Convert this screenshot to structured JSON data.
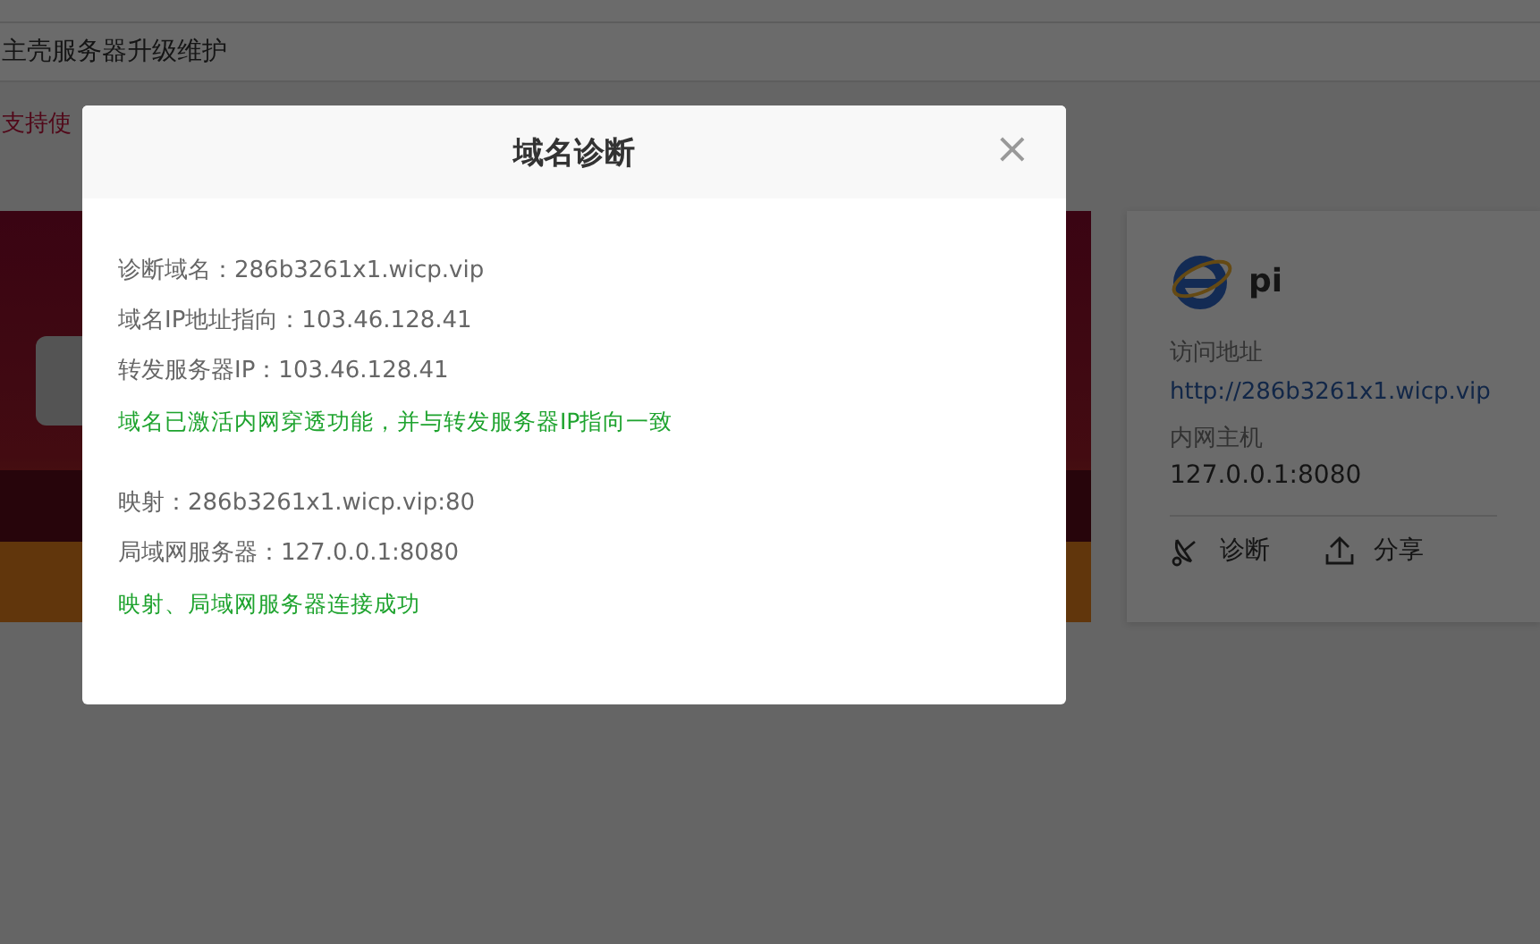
{
  "notice": {
    "text": "主壳服务器升级维护"
  },
  "tip": {
    "text": "支持使"
  },
  "card": {
    "title": "pi",
    "url_label": "访问地址",
    "url": "http://286b3261x1.wicp.vip",
    "host_label": "内网主机",
    "host": "127.0.0.1:8080",
    "actions": [
      {
        "kind": "diagnose",
        "label": "诊断"
      },
      {
        "kind": "share",
        "label": "分享"
      }
    ]
  },
  "dialog": {
    "title": "域名诊断",
    "close": "×",
    "groups": [
      {
        "lines": [
          {
            "kind": "info",
            "text": "诊断域名：286b3261x1.wicp.vip"
          },
          {
            "kind": "info",
            "text": "域名IP地址指向：103.46.128.41"
          },
          {
            "kind": "info",
            "text": "转发服务器IP：103.46.128.41"
          },
          {
            "kind": "success",
            "text": "域名已激活内网穿透功能，并与转发服务器IP指向一致"
          }
        ]
      },
      {
        "lines": [
          {
            "kind": "info",
            "text": "映射：286b3261x1.wicp.vip:80"
          },
          {
            "kind": "info",
            "text": "局域网服务器：127.0.0.1:8080"
          },
          {
            "kind": "success",
            "text": "映射、局域网服务器连接成功"
          }
        ]
      }
    ]
  }
}
